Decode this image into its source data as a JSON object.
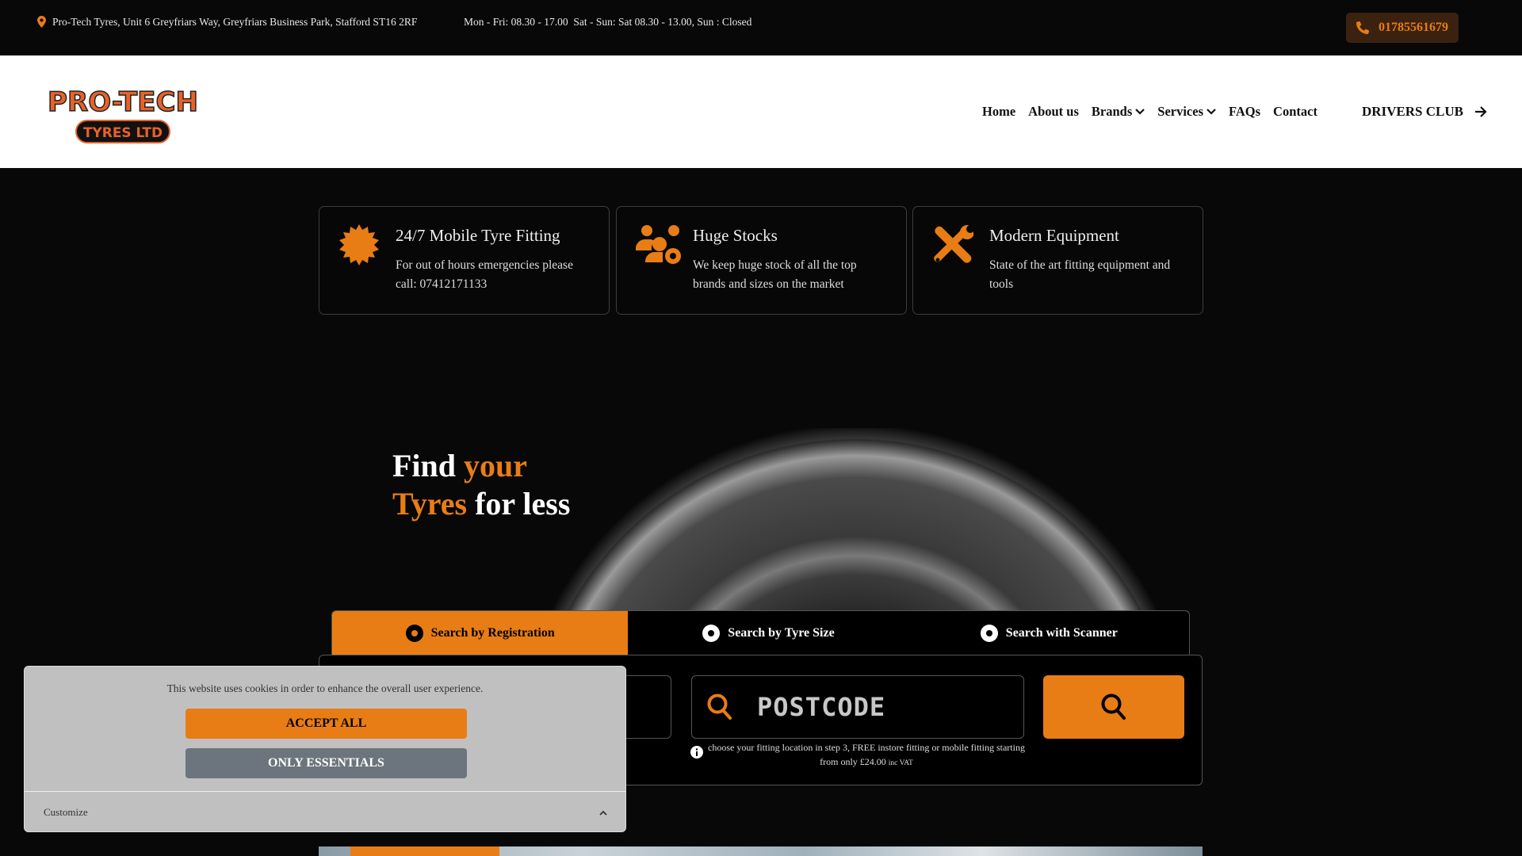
{
  "topbar": {
    "address": "Pro-Tech Tyres, Unit 6 Greyfriars Way, Greyfriars Business Park, Stafford ST16 2RF",
    "hours": "Mon - Fri: 08.30 - 17.00  Sat - Sun: Sat 08.30 - 13.00, Sun : Closed",
    "phone": "01785561679"
  },
  "logo": {
    "line1": "PRO-TECH",
    "line2": "TYRES LTD"
  },
  "nav": {
    "items": [
      "Home",
      "About us",
      "Brands",
      "Services",
      "FAQs",
      "Contact"
    ],
    "drivers_club": "DRIVERS CLUB"
  },
  "features": [
    {
      "title": "24/7 Mobile Tyre Fitting",
      "text": "For out of hours emergencies please call: 07412171133",
      "icon": "badge-icon"
    },
    {
      "title": "Huge Stocks",
      "text": "We keep huge stock of all the top brands and sizes on the market",
      "icon": "users-gear-icon"
    },
    {
      "title": "Modern Equipment",
      "text": "State of the art fitting equipment and tools",
      "icon": "tools-icon"
    }
  ],
  "hero": {
    "w1": "Find",
    "w2": "your",
    "w3": "Tyres",
    "w4": "for less"
  },
  "tabs": [
    "Search by Registration",
    "Search by Tyre Size",
    "Search with Scanner"
  ],
  "search": {
    "postcode_placeholder": "POSTCODE",
    "note": "choose your fitting location in step 3, FREE instore fitting or mobile fitting starting from only £24.00",
    "note_small": "inc VAT"
  },
  "cookie": {
    "message": "This website uses cookies in order to enhance the overall user experience.",
    "accept": "ACCEPT ALL",
    "essentials": "ONLY ESSENTIALS",
    "customize": "Customize"
  },
  "colors": {
    "accent": "#e87d15",
    "dark": "#080808"
  }
}
